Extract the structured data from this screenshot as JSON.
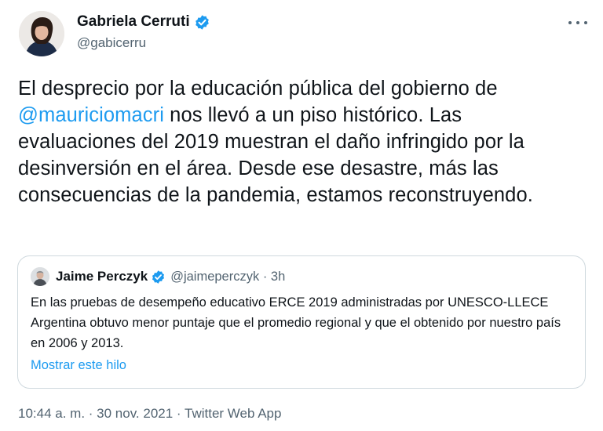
{
  "tweet": {
    "author_name": "Gabriela Cerruti",
    "author_handle": "@gabicerru",
    "text_before_mention": "El desprecio por la educación pública del gobierno de ",
    "mention": "@mauriciomacri",
    "text_after_mention": " nos llevó a un piso histórico. Las evaluaciones del 2019 muestran el daño infringido por la desinversión en el área. Desde ese desastre, más las consecuencias de la pandemia, estamos reconstruyendo.",
    "footer": "10:44 a. m. · 30 nov. 2021 · Twitter Web App"
  },
  "quote": {
    "author_name": "Jaime Perczyk",
    "meta": "@jaimeperczyk · 3h",
    "text": "En las pruebas de desempeño educativo ERCE 2019 administradas por UNESCO-LLECE Argentina obtuvo menor puntaje que el promedio regional y que el obtenido por nuestro país en 2006 y 2013.",
    "show_thread": "Mostrar este hilo"
  },
  "icons": {
    "verified": "verified-badge-icon",
    "more": "more-options-icon"
  },
  "colors": {
    "accent": "#1d9bf0",
    "text": "#0f1419",
    "secondary": "#536471",
    "border": "#cfd9de"
  }
}
